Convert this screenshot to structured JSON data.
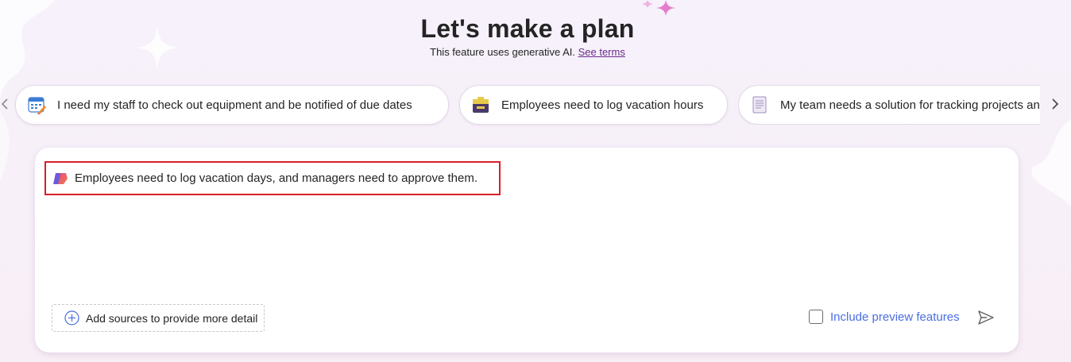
{
  "header": {
    "title": "Let's make a plan",
    "subtitle": "This feature uses generative AI.",
    "terms_link": "See terms"
  },
  "suggestions": [
    {
      "label": "I need my staff to check out equipment and be notified of due dates",
      "icon": "calendar-icon"
    },
    {
      "label": "Employees need to log vacation hours",
      "icon": "briefcase-icon"
    },
    {
      "label": "My team needs a solution for tracking projects and tasks",
      "icon": "document-icon"
    }
  ],
  "prompt": {
    "text": "Employees need to log vacation days, and managers need to approve them.",
    "icon": "copilot-icon"
  },
  "footer": {
    "add_sources_label": "Add sources to provide more detail",
    "preview_label": "Include preview features",
    "preview_checked": false
  },
  "colors": {
    "accent_link": "#6a2a8c",
    "preview_text": "#4a6ee0",
    "highlight_border": "#d7202a"
  }
}
